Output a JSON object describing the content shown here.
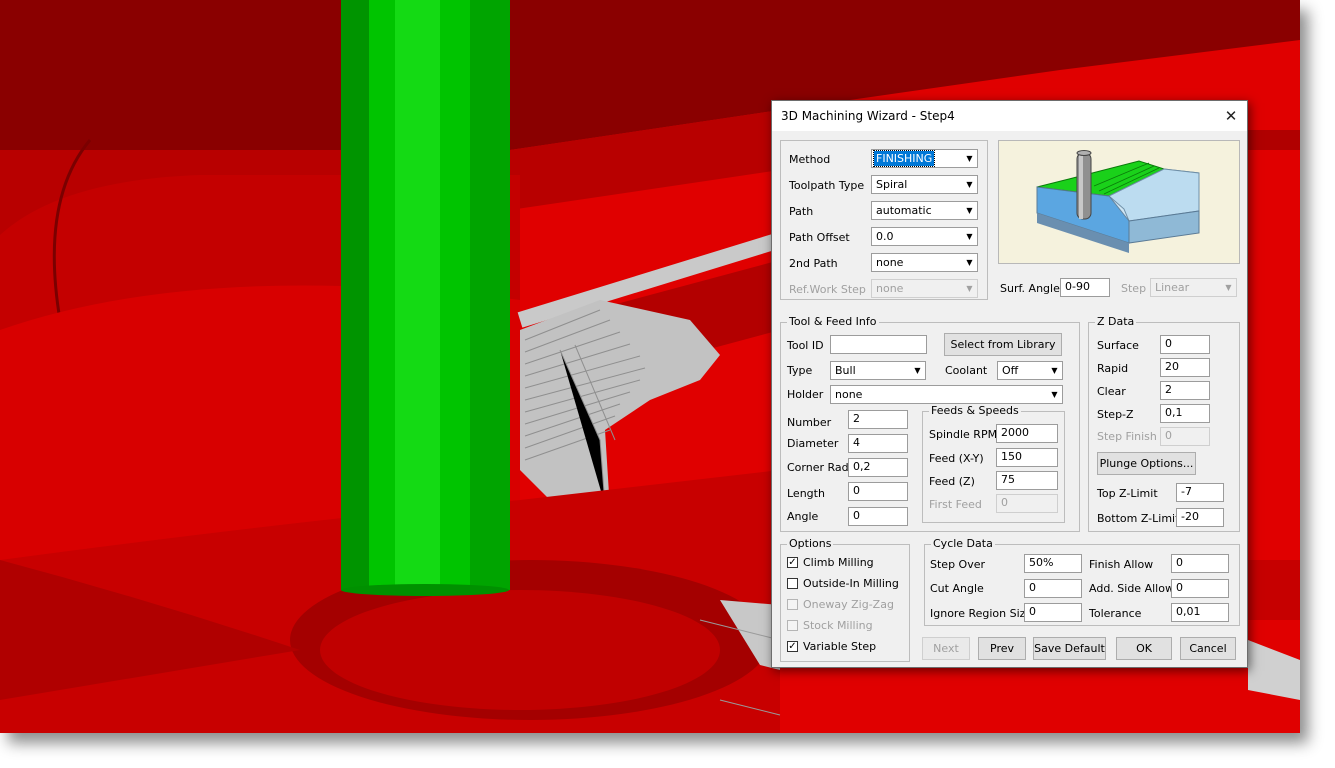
{
  "dialog": {
    "title": "3D Machining Wizard - Step4",
    "close_glyph": "✕",
    "method": {
      "label": "Method",
      "value": "FINISHING"
    },
    "toolpath_type": {
      "label": "Toolpath Type",
      "value": "Spiral"
    },
    "path": {
      "label": "Path",
      "value": "automatic"
    },
    "path_offset": {
      "label": "Path Offset",
      "value": "0.0"
    },
    "second_path": {
      "label": "2nd Path",
      "value": "none"
    },
    "ref_work_step": {
      "label": "Ref.Work Step",
      "value": "none"
    },
    "surf_angle": {
      "label": "Surf. Angle",
      "value": "0-90"
    },
    "step": {
      "label": "Step",
      "value": "Linear"
    },
    "tool_feed": {
      "legend": "Tool & Feed Info",
      "tool_id": {
        "label": "Tool ID",
        "value": ""
      },
      "select_library": "Select from Library",
      "type": {
        "label": "Type",
        "value": "Bull"
      },
      "coolant": {
        "label": "Coolant",
        "value": "Off"
      },
      "holder": {
        "label": "Holder",
        "value": "none"
      },
      "number": {
        "label": "Number",
        "value": "2"
      },
      "diameter": {
        "label": "Diameter",
        "value": "4"
      },
      "corner_rad": {
        "label": "Corner Rad",
        "value": "0,2"
      },
      "length": {
        "label": "Length",
        "value": "0"
      },
      "angle": {
        "label": "Angle",
        "value": "0"
      },
      "feeds": {
        "legend": "Feeds & Speeds",
        "spindle": {
          "label": "Spindle RPM",
          "value": "2000"
        },
        "feed_xy": {
          "label": "Feed (X-Y)",
          "value": "150"
        },
        "feed_z": {
          "label": "Feed (Z)",
          "value": "75"
        },
        "first_feed": {
          "label": "First Feed",
          "value": "0"
        }
      }
    },
    "zdata": {
      "legend": "Z Data",
      "surface": {
        "label": "Surface",
        "value": "0"
      },
      "rapid": {
        "label": "Rapid",
        "value": "20"
      },
      "clear": {
        "label": "Clear",
        "value": "2"
      },
      "stepz": {
        "label": "Step-Z",
        "value": "0,1"
      },
      "step_finish": {
        "label": "Step Finish",
        "value": "0"
      },
      "plunge": "Plunge Options...",
      "top_limit": {
        "label": "Top Z-Limit",
        "value": "-7"
      },
      "bottom_limit": {
        "label": "Bottom Z-Limit",
        "value": "-20"
      }
    },
    "options": {
      "legend": "Options",
      "items": [
        {
          "label": "Climb Milling",
          "checked": true,
          "enabled": true
        },
        {
          "label": "Outside-In Milling",
          "checked": false,
          "enabled": true
        },
        {
          "label": "Oneway Zig-Zag",
          "checked": false,
          "enabled": false
        },
        {
          "label": "Stock Milling",
          "checked": false,
          "enabled": false
        },
        {
          "label": "Variable Step",
          "checked": true,
          "enabled": true
        }
      ]
    },
    "cycle": {
      "legend": "Cycle Data",
      "step_over": {
        "label": "Step Over",
        "value": "50%"
      },
      "cut_angle": {
        "label": "Cut Angle",
        "value": "0"
      },
      "ignore_region": {
        "label": "Ignore Region Size",
        "value": "0"
      },
      "finish_allow": {
        "label": "Finish Allow",
        "value": "0"
      },
      "add_side_allow": {
        "label": "Add. Side Allow",
        "value": "0"
      },
      "tolerance": {
        "label": "Tolerance",
        "value": "0,01"
      }
    },
    "buttons": {
      "next": "Next",
      "prev": "Prev",
      "save_default": "Save Default",
      "ok": "OK",
      "cancel": "Cancel"
    }
  }
}
